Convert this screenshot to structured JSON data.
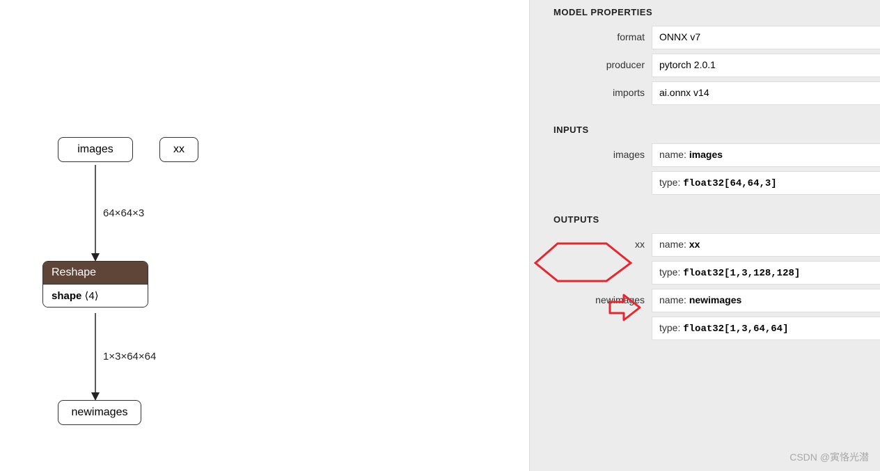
{
  "graph": {
    "inputs": [
      {
        "id": "images",
        "label": "images"
      },
      {
        "id": "xx",
        "label": "xx"
      }
    ],
    "op": {
      "name": "Reshape",
      "attr_key": "shape",
      "attr_val": "⟨4⟩"
    },
    "edges": [
      {
        "id": "e1",
        "label": "64×64×3"
      },
      {
        "id": "e2",
        "label": "1×3×64×64"
      }
    ],
    "output": {
      "id": "newimages",
      "label": "newimages"
    }
  },
  "sidebar": {
    "sections": {
      "model_properties": "MODEL PROPERTIES",
      "inputs": "INPUTS",
      "outputs": "OUTPUTS"
    },
    "model": {
      "format": {
        "label": "format",
        "value": "ONNX v7"
      },
      "producer": {
        "label": "producer",
        "value": "pytorch 2.0.1"
      },
      "imports": {
        "label": "imports",
        "value": "ai.onnx v14"
      }
    },
    "inputs": {
      "images": {
        "label": "images",
        "name_k": "name:",
        "name_v": "images",
        "type_k": "type:",
        "type_v": "float32[64,64,3]"
      }
    },
    "outputs": {
      "xx": {
        "label": "xx",
        "name_k": "name:",
        "name_v": "xx",
        "type_k": "type:",
        "type_v": "float32[1,3,128,128]"
      },
      "newimages": {
        "label": "newimages",
        "name_k": "name:",
        "name_v": "newimages",
        "type_k": "type:",
        "type_v": "float32[1,3,64,64]"
      }
    }
  },
  "watermark": "CSDN @寅恪光潜"
}
